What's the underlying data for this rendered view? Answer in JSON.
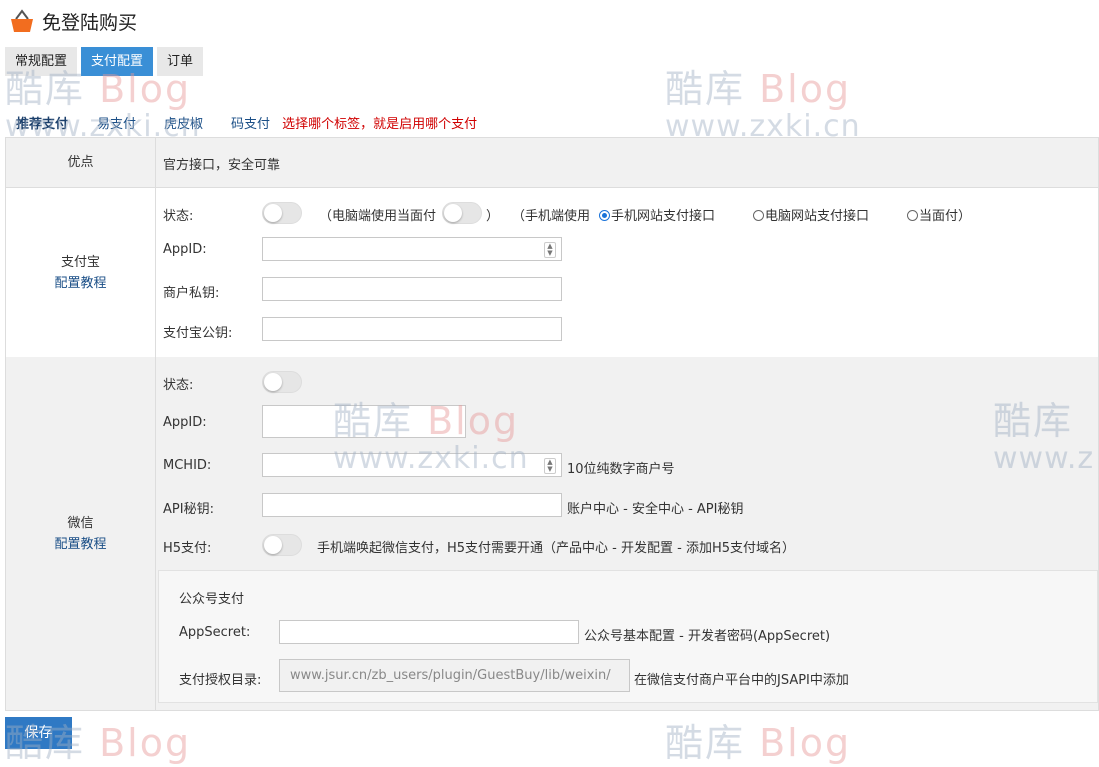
{
  "header": {
    "title": "免登陆购买",
    "icon": "basket-icon"
  },
  "tabs": [
    {
      "label": "常规配置",
      "active": false
    },
    {
      "label": "支付配置",
      "active": true
    },
    {
      "label": "订单",
      "active": false
    }
  ],
  "subtabs": [
    {
      "label": "推荐支付",
      "active": true
    },
    {
      "label": "易支付",
      "active": false
    },
    {
      "label": "虎皮椒",
      "active": false
    },
    {
      "label": "码支付",
      "active": false
    }
  ],
  "subtab_note": "选择哪个标签，就是启用哪个支付",
  "advantage": {
    "label": "优点",
    "text": "官方接口，安全可靠"
  },
  "alipay": {
    "title": "支付宝",
    "tutorial": "配置教程",
    "status_label": "状态:",
    "pc_prefix": "（电脑端使用当面付",
    "pc_suffix": "）",
    "mobile_prefix": "（手机端使用",
    "radio_mobile": "手机网站支付接口",
    "radio_pc": "电脑网站支付接口",
    "radio_f2f": "当面付）",
    "appid_label": "AppID:",
    "privkey_label": "商户私钥:",
    "pubkey_label": "支付宝公钥:"
  },
  "wechat": {
    "title": "微信",
    "tutorial": "配置教程",
    "status_label": "状态:",
    "appid_label": "AppID:",
    "mchid_label": "MCHID:",
    "mchid_hint": "10位纯数字商户号",
    "apikey_label": "API秘钥:",
    "apikey_hint": "账户中心 - 安全中心 - API秘钥",
    "h5_label": "H5支付:",
    "h5_hint": "手机端唤起微信支付，H5支付需要开通（产品中心 - 开发配置 - 添加H5支付域名）",
    "mp_title": "公众号支付",
    "appsecret_label": "AppSecret:",
    "appsecret_hint": "公众号基本配置 - 开发者密码(AppSecret)",
    "authdir_label": "支付授权目录:",
    "authdir_value": "www.jsur.cn/zb_users/plugin/GuestBuy/lib/weixin/",
    "authdir_hint": "在微信支付商户平台中的JSAPI中添加"
  },
  "save_label": "保存",
  "watermark": {
    "line1a": "酷库",
    "line1b": "Blog",
    "line2": "www.zxki.cn"
  },
  "colors": {
    "accent": "#3a8fd6",
    "note": "#d00000",
    "link": "#1b4f87"
  }
}
